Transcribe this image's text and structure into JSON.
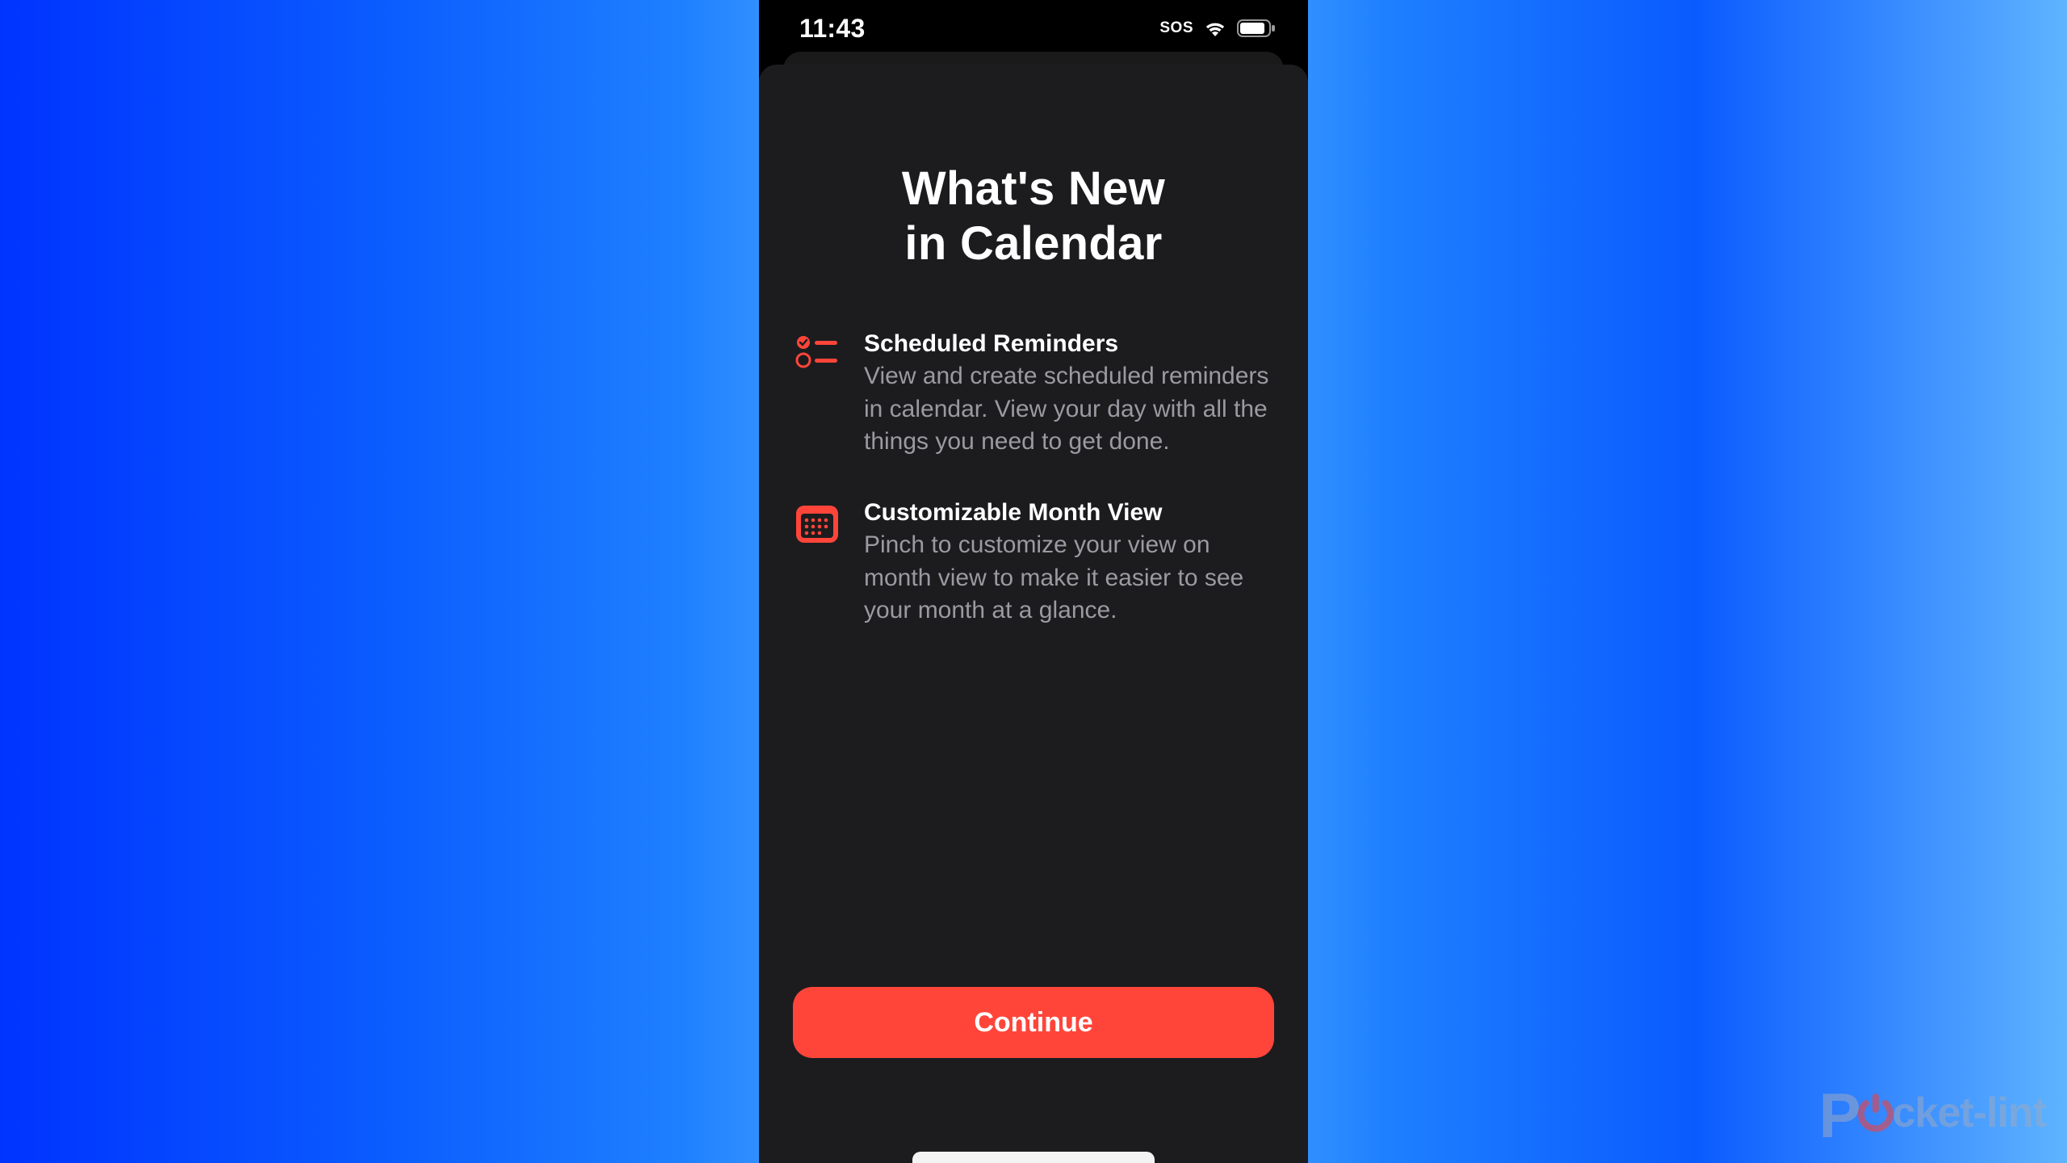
{
  "status_bar": {
    "time": "11:43",
    "sos": "SOS"
  },
  "sheet": {
    "title_line1": "What's New",
    "title_line2": "in Calendar",
    "features": [
      {
        "icon": "checklist-icon",
        "title": "Scheduled Reminders",
        "desc": "View and create scheduled reminders in calendar. View your day with all the things you need to get done."
      },
      {
        "icon": "calendar-icon",
        "title": "Customizable Month View",
        "desc": "Pinch to customize your view on month view to make it easier to see your month at a glance."
      }
    ],
    "continue_label": "Continue"
  },
  "watermark": {
    "brand_prefix": "P",
    "brand_suffix": "cket-lint"
  },
  "colors": {
    "accent": "#ff453a",
    "sheet_bg": "#1c1c1e",
    "text_secondary": "#9a9aa0"
  }
}
